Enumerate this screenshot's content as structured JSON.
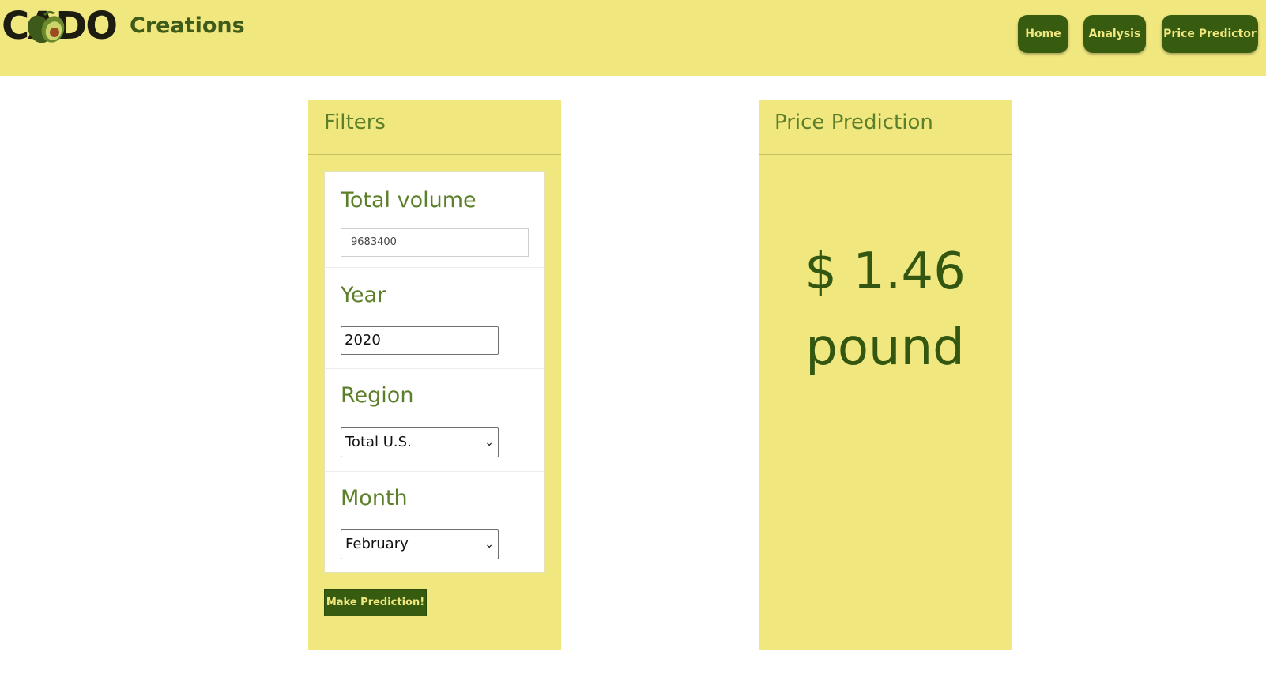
{
  "header": {
    "logo_mark": "CADO",
    "logo_word": "Creations",
    "nav": [
      {
        "label": "Home"
      },
      {
        "label": "Analysis"
      },
      {
        "label": "Price Predictor"
      }
    ]
  },
  "filters": {
    "title": "Filters",
    "total_volume": {
      "label": "Total volume",
      "value": "9683400"
    },
    "year": {
      "label": "Year",
      "value": "2020"
    },
    "region": {
      "label": "Region",
      "selected": "Total U.S."
    },
    "month": {
      "label": "Month",
      "selected": "February"
    },
    "submit_label": "Make Prediction!"
  },
  "prediction": {
    "title": "Price Prediction",
    "price": "$ 1.46",
    "unit": "pound"
  },
  "colors": {
    "banner": "#f0e77f",
    "accent_dark_green": "#375c10",
    "label_green": "#5c7f2a"
  }
}
